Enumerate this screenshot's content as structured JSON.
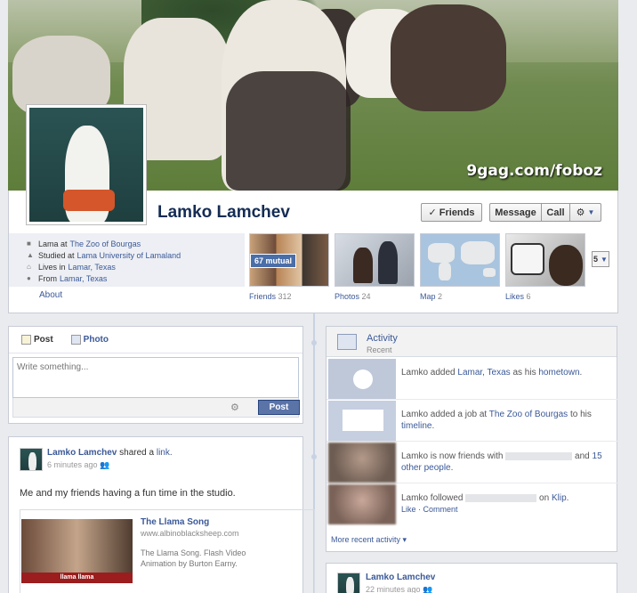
{
  "cover": {
    "watermark": "9gag.com/foboz"
  },
  "profile": {
    "name": "Lamko Lamchev"
  },
  "buttons": {
    "friends": "✓ Friends",
    "message": "Message",
    "call": "Call",
    "gear": "⚙",
    "more": "5"
  },
  "info": {
    "lines": [
      {
        "prefix": "Lama at ",
        "link": "The Zoo of Bourgas",
        "suffix": ""
      },
      {
        "prefix": "Studied at ",
        "link": "Lama University of Lamaland",
        "suffix": ""
      },
      {
        "prefix": "Lives in ",
        "link": "Lamar, Texas",
        "suffix": ""
      },
      {
        "prefix": "From ",
        "link": "Lamar, Texas",
        "suffix": ""
      }
    ],
    "about": "About"
  },
  "thumbs": {
    "friends": {
      "label": "Friends",
      "count": "312",
      "mutual": "67 mutual"
    },
    "photos": {
      "label": "Photos",
      "count": "24"
    },
    "map": {
      "label": "Map",
      "count": "2"
    },
    "likes": {
      "label": "Likes",
      "count": "6"
    }
  },
  "composer": {
    "tab_post": "Post",
    "tab_photo": "Photo",
    "placeholder": "Write something...",
    "post_button": "Post"
  },
  "story": {
    "author": "Lamko Lamchev",
    "action": " shared a ",
    "action_link": "link.",
    "time": "6 minutes ago",
    "text": "Me and my friends having a fun time in the studio.",
    "share_title": "The Llama Song",
    "share_url": "www.albinoblacksheep.com",
    "share_desc": "The Llama Song. Flash Video Animation by Burton Earny.",
    "share_caption": "llama llama"
  },
  "activity": {
    "title": "Activity",
    "subtitle": "Recent",
    "rows": [
      {
        "parts": [
          "Lamko added ",
          "Lamar, Texas",
          " as his ",
          "hometown",
          "."
        ]
      },
      {
        "parts": [
          "Lamko added a job at ",
          "The Zoo of Bourgas",
          " to his ",
          "timeline",
          "."
        ]
      },
      {
        "a": "Lamko is now friends with ",
        "b": " and ",
        "c": "15 other people",
        "d": "."
      },
      {
        "a": "Lamko followed ",
        "b": " on ",
        "c": "Klip",
        "d": ".",
        "like": "Like",
        "sep": " · ",
        "comment": "Comment"
      }
    ],
    "more": "More recent activity"
  },
  "story2": {
    "author": "Lamko Lamchev",
    "time": "22 minutes ago"
  }
}
